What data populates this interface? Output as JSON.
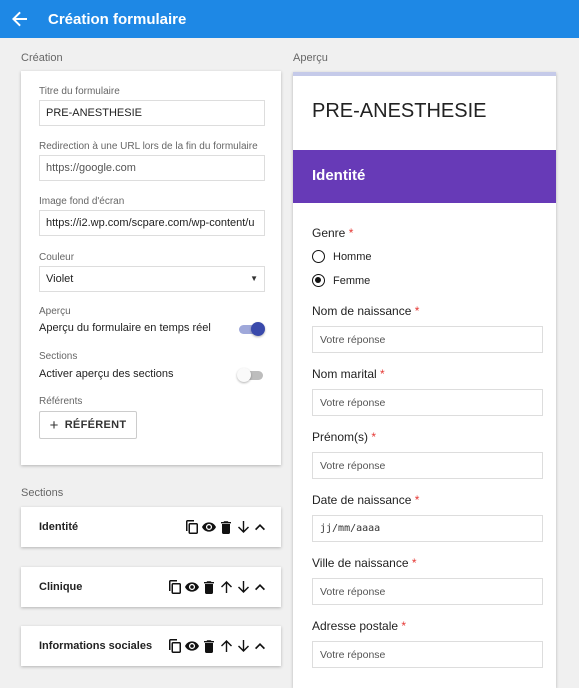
{
  "appbar": {
    "title": "Création formulaire",
    "back_icon": "arrow-left-icon",
    "color": "#1e88e5"
  },
  "creation": {
    "heading": "Création",
    "form_title": {
      "label": "Titre du formulaire",
      "value": "PRE-ANESTHESIE"
    },
    "redirect": {
      "label": "Redirection à une URL lors de la fin du formulaire",
      "value": "https://google.com"
    },
    "background": {
      "label": "Image fond d'écran",
      "value": "https://i2.wp.com/scpare.com/wp-content/u"
    },
    "color": {
      "label": "Couleur",
      "value": "Violet"
    },
    "preview": {
      "label": "Aperçu",
      "text": "Aperçu du formulaire en temps réel",
      "enabled": true
    },
    "sections_toggle": {
      "label": "Sections",
      "text": "Activer aperçu des sections",
      "enabled": false
    },
    "referents": {
      "label": "Référents",
      "button": "RÉFÉRENT"
    }
  },
  "sections": {
    "heading": "Sections",
    "items": [
      {
        "name": "Identité",
        "icons": [
          "copy-icon",
          "eye-icon",
          "trash-icon",
          "arrow-down-icon",
          "chevron-up-icon"
        ]
      },
      {
        "name": "Clinique",
        "icons": [
          "copy-icon",
          "eye-icon",
          "trash-icon",
          "arrow-up-icon",
          "arrow-down-icon",
          "chevron-up-icon"
        ]
      },
      {
        "name": "Informations sociales",
        "icons": [
          "copy-icon",
          "eye-icon",
          "trash-icon",
          "arrow-up-icon",
          "arrow-down-icon",
          "chevron-up-icon"
        ]
      }
    ]
  },
  "apercu": {
    "heading": "Aperçu",
    "form_title": "PRE-ANESTHESIE",
    "section_title": "Identité",
    "accent": "#673ab7",
    "required_mark": "*",
    "genre": {
      "label": "Genre",
      "options": [
        "Homme",
        "Femme"
      ],
      "selected": "Femme"
    },
    "questions": [
      {
        "label": "Nom de naissance",
        "placeholder": "Votre réponse"
      },
      {
        "label": "Nom marital",
        "placeholder": "Votre réponse"
      },
      {
        "label": "Prénom(s)",
        "placeholder": "Votre réponse"
      },
      {
        "label": "Date de naissance",
        "placeholder": "jj/mm/aaaa"
      },
      {
        "label": "Ville de naissance",
        "placeholder": "Votre réponse"
      },
      {
        "label": "Adresse postale",
        "placeholder": "Votre réponse"
      }
    ]
  }
}
